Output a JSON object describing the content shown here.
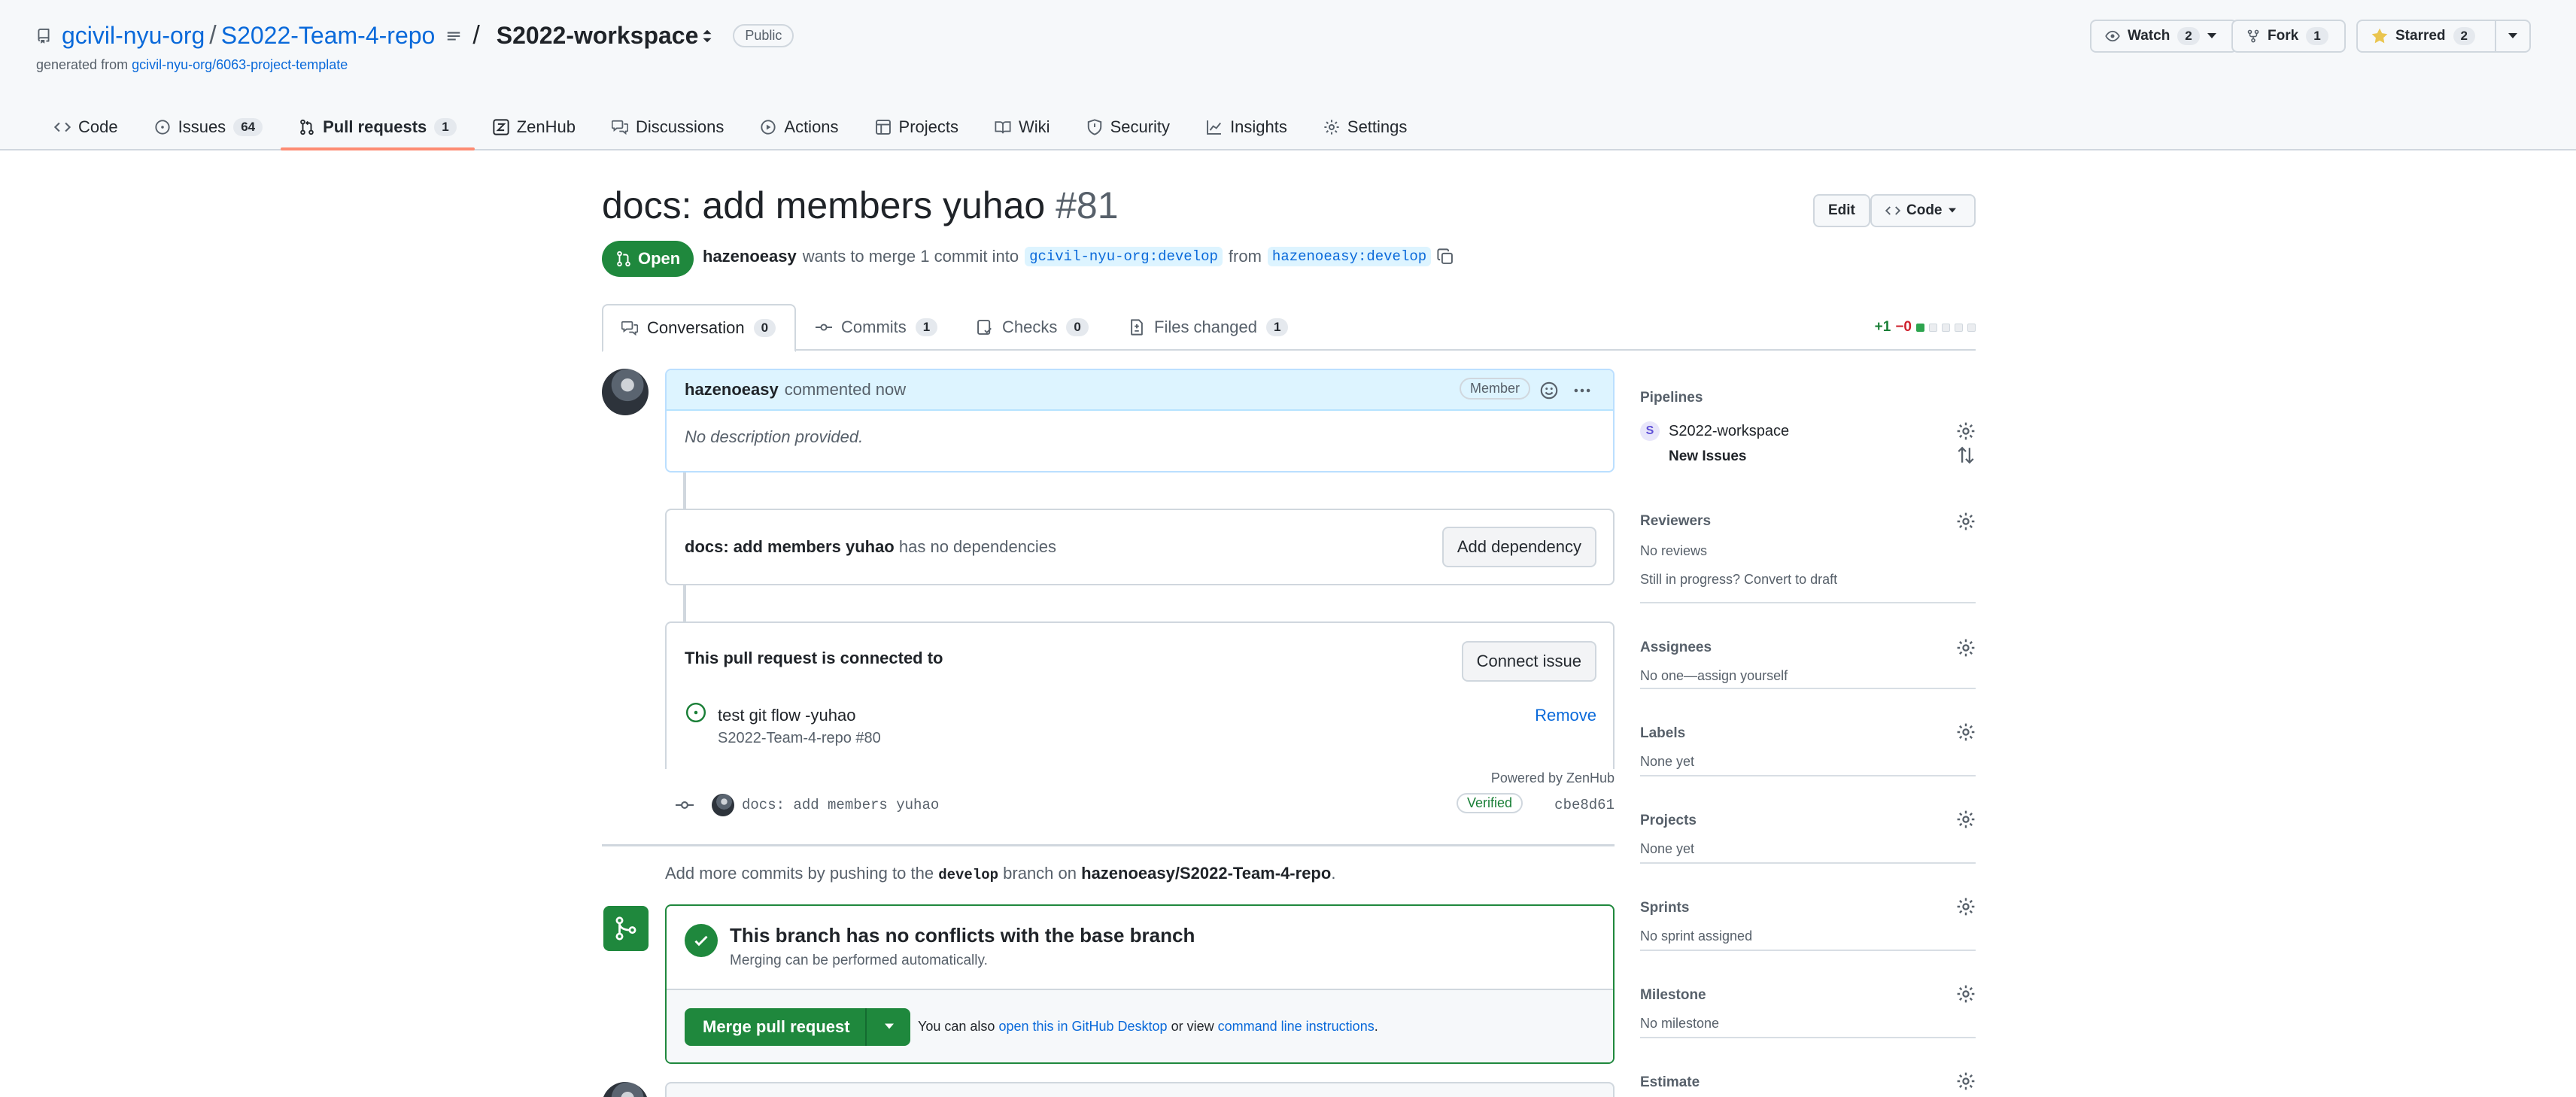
{
  "repo": {
    "owner": "gcivil-nyu-org",
    "slash": "/",
    "name": "S2022-Team-4-repo",
    "separator": "/",
    "workspace": "S2022-workspace",
    "visibility": "Public",
    "generated_prefix": "generated from",
    "generated_link": "gcivil-nyu-org/6063-project-template"
  },
  "header_buttons": {
    "watch_label": "Watch",
    "watch_count": "2",
    "fork_label": "Fork",
    "fork_count": "1",
    "star_label": "Starred",
    "star_count": "2"
  },
  "tabs": [
    {
      "label": "Code",
      "icon": "code-icon"
    },
    {
      "label": "Issues",
      "count": "64",
      "icon": "issue-icon"
    },
    {
      "label": "Pull requests",
      "count": "1",
      "icon": "pull-request-icon",
      "active": true
    },
    {
      "label": "ZenHub",
      "icon": "zenhub-icon"
    },
    {
      "label": "Discussions",
      "icon": "discussions-icon"
    },
    {
      "label": "Actions",
      "icon": "play-icon"
    },
    {
      "label": "Projects",
      "icon": "table-icon"
    },
    {
      "label": "Wiki",
      "icon": "book-icon"
    },
    {
      "label": "Security",
      "icon": "shield-icon"
    },
    {
      "label": "Insights",
      "icon": "graph-icon"
    },
    {
      "label": "Settings",
      "icon": "gear-icon"
    }
  ],
  "pr": {
    "title": "docs: add members yuhao",
    "number": "#81",
    "edit_label": "Edit",
    "code_label": "Code",
    "state": "Open",
    "author": "hazenoeasy",
    "meta_text": "wants to merge 1 commit into",
    "base_branch": "gcivil-nyu-org:develop",
    "from_text": "from",
    "head_branch": "hazenoeasy:develop"
  },
  "pr_tabs": [
    {
      "label": "Conversation",
      "count": "0",
      "active": true
    },
    {
      "label": "Commits",
      "count": "1"
    },
    {
      "label": "Checks",
      "count": "0"
    },
    {
      "label": "Files changed",
      "count": "1"
    }
  ],
  "diffstat": {
    "added": "+1",
    "removed": "−0"
  },
  "comment": {
    "author": "hazenoeasy",
    "action": "commented now",
    "badge": "Member",
    "body": "No description provided."
  },
  "dependency": {
    "title": "docs: add members yuhao",
    "status": "has no dependencies",
    "button": "Add dependency"
  },
  "connection": {
    "heading": "This pull request is connected to",
    "button": "Connect issue",
    "issue_title": "test git flow -yuhao",
    "issue_ref": "S2022-Team-4-repo #80",
    "remove_label": "Remove",
    "powered_by": "Powered by ZenHub"
  },
  "commit": {
    "message": "docs: add members yuhao",
    "verified": "Verified",
    "sha": "cbe8d61"
  },
  "push_note": {
    "prefix": "Add more commits by pushing to the",
    "branch": "develop",
    "middle": "branch on",
    "repo": "hazenoeasy/S2022-Team-4-repo",
    "suffix": "."
  },
  "merge": {
    "title": "This branch has no conflicts with the base branch",
    "subtitle": "Merging can be performed automatically.",
    "button": "Merge pull request",
    "also_prefix": "You can also",
    "desktop_link": "open this in GitHub Desktop",
    "or_view": "or view",
    "cli_link": "command line instructions",
    "suffix": "."
  },
  "sidebar": {
    "pipelines": {
      "title": "Pipelines",
      "workspace_letter": "S",
      "workspace": "S2022-workspace",
      "pipeline": "New Issues"
    },
    "reviewers": {
      "title": "Reviewers",
      "value": "No reviews",
      "draft_note": "Still in progress? Convert to draft"
    },
    "assignees": {
      "title": "Assignees",
      "value": "No one—assign yourself"
    },
    "labels": {
      "title": "Labels",
      "value": "None yet"
    },
    "projects": {
      "title": "Projects",
      "value": "None yet"
    },
    "sprints": {
      "title": "Sprints",
      "value": "No sprint assigned"
    },
    "milestone": {
      "title": "Milestone",
      "value": "No milestone"
    },
    "estimate": {
      "title": "Estimate"
    }
  },
  "colors": {
    "accent": "#0969da",
    "success": "#1f883d",
    "tab_underline": "#fd8c73"
  }
}
